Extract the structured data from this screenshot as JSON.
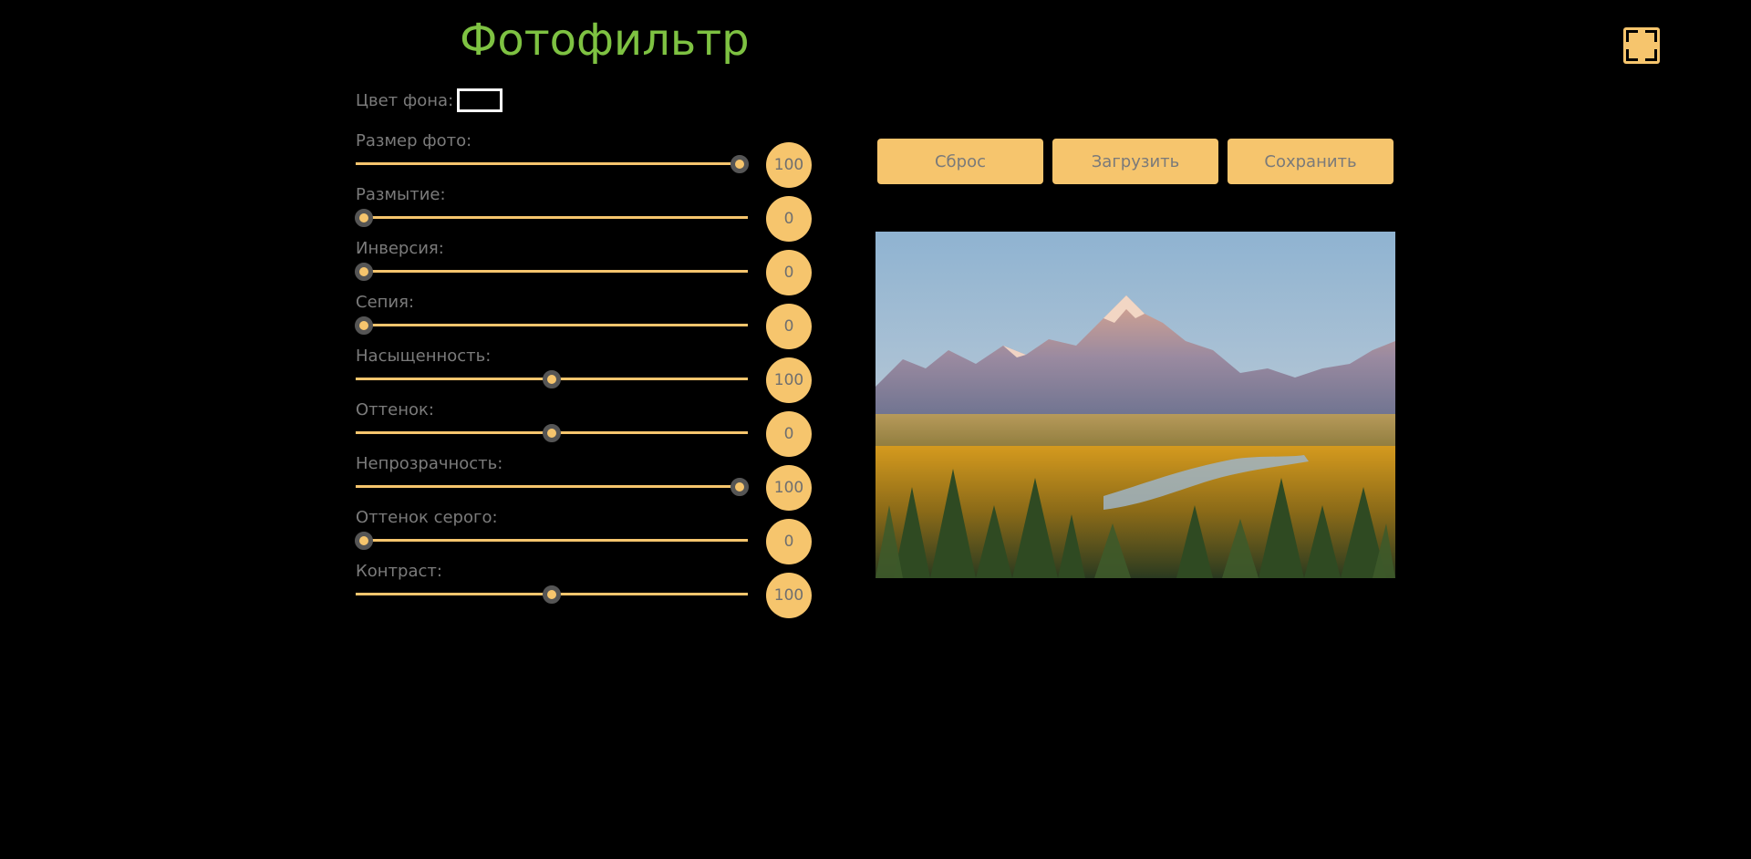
{
  "header": {
    "title": "Фотофильтр"
  },
  "background": {
    "label": "Цвет фона:",
    "color": "#000000"
  },
  "sliders": [
    {
      "label": "Размер фото:",
      "value": "100",
      "position": 0.98
    },
    {
      "label": "Размытие:",
      "value": "0",
      "position": 0.02
    },
    {
      "label": "Инверсия:",
      "value": "0",
      "position": 0.02
    },
    {
      "label": "Сепия:",
      "value": "0",
      "position": 0.02
    },
    {
      "label": "Насыщенность:",
      "value": "100",
      "position": 0.5
    },
    {
      "label": "Оттенок:",
      "value": "0",
      "position": 0.5
    },
    {
      "label": "Непрозрачность:",
      "value": "100",
      "position": 0.98
    },
    {
      "label": "Оттенок серого:",
      "value": "0",
      "position": 0.02
    },
    {
      "label": "Контраст:",
      "value": "100",
      "position": 0.5
    }
  ],
  "actions": {
    "reset_label": "Сброс",
    "upload_label": "Загрузить",
    "save_label": "Сохранить"
  },
  "colors": {
    "accent": "#f6c56d",
    "title": "#7ec242",
    "label": "#7b7b7b",
    "background": "#000000"
  },
  "icons": {
    "fullscreen": "fullscreen-icon"
  }
}
